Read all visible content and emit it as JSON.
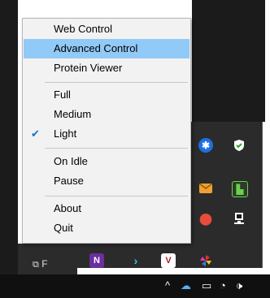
{
  "menu": {
    "items": [
      {
        "label": "Web Control"
      },
      {
        "label": "Advanced Control"
      },
      {
        "label": "Protein Viewer"
      },
      {
        "label": "Full"
      },
      {
        "label": "Medium"
      },
      {
        "label": "Light",
        "checked": true
      },
      {
        "label": "On Idle"
      },
      {
        "label": "Pause"
      },
      {
        "label": "About"
      },
      {
        "label": "Quit"
      }
    ],
    "highlighted_item": "Advanced Control"
  },
  "tray": {
    "icons": [
      "bluetooth-icon",
      "security-shield-icon",
      "mail-icon",
      "monitor-app-icon",
      "record-icon",
      "network-drive-icon",
      "vs-icon",
      "powershell-icon",
      "vv-icon",
      "pinwheel-icon"
    ]
  },
  "window_label": "F",
  "taskbar": {
    "icons": [
      "chevron-up-icon",
      "cloud-icon",
      "battery-icon",
      "wifi-icon",
      "volume-icon"
    ]
  },
  "colors": {
    "menu_bg": "#f2f2f2",
    "highlight": "#91c9f7",
    "check": "#1a6fc9",
    "dark": "#1b1b1b"
  }
}
